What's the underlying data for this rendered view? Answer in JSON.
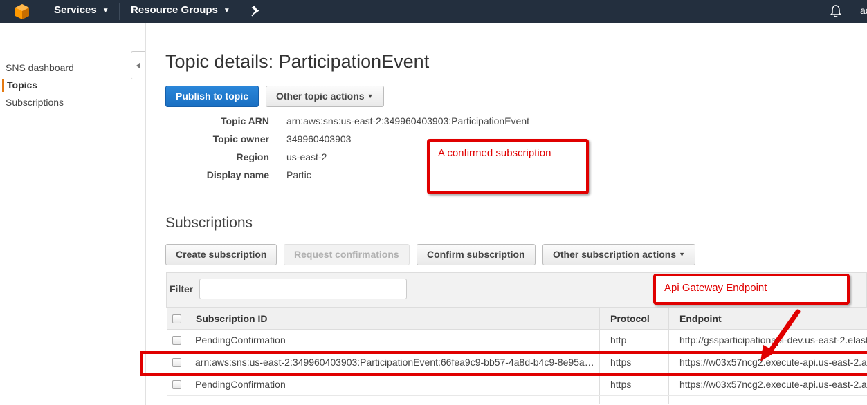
{
  "nav": {
    "services_label": "Services",
    "resource_groups_label": "Resource Groups",
    "user_truncated": "ad",
    "accent": "#f90",
    "bar_color": "#232f3e"
  },
  "sidebar": {
    "items": [
      {
        "label": "SNS dashboard"
      },
      {
        "label": "Topics",
        "active": true
      },
      {
        "label": "Subscriptions"
      }
    ]
  },
  "main": {
    "title": "Topic details: ParticipationEvent",
    "publish_button": "Publish to topic",
    "other_topic_actions": "Other topic actions",
    "details": [
      {
        "label": "Topic ARN",
        "value": "arn:aws:sns:us-east-2:349960403903:ParticipationEvent"
      },
      {
        "label": "Topic owner",
        "value": "349960403903"
      },
      {
        "label": "Region",
        "value": "us-east-2"
      },
      {
        "label": "Display name",
        "value": "Partic"
      }
    ]
  },
  "subscriptions": {
    "title": "Subscriptions",
    "buttons": {
      "create": "Create subscription",
      "request": "Request confirmations",
      "confirm": "Confirm subscription",
      "other": "Other subscription actions"
    },
    "filter_label": "Filter",
    "filter_value": "",
    "columns": [
      "Subscription ID",
      "Protocol",
      "Endpoint"
    ],
    "rows": [
      {
        "id": "PendingConfirmation",
        "protocol": "http",
        "endpoint": "http://gssparticipationapi-dev.us-east-2.elast"
      },
      {
        "id": "arn:aws:sns:us-east-2:349960403903:ParticipationEvent:66fea9c9-bb57-4a8d-b4c9-8e95a…",
        "protocol": "https",
        "endpoint": "https://w03x57ncg2.execute-api.us-east-2.a"
      },
      {
        "id": "PendingConfirmation",
        "protocol": "https",
        "endpoint": "https://w03x57ncg2.execute-api.us-east-2.a"
      }
    ]
  },
  "annotations": {
    "confirmed": "A confirmed subscription",
    "endpoint": "Api Gateway Endpoint",
    "color": "#e00000"
  }
}
